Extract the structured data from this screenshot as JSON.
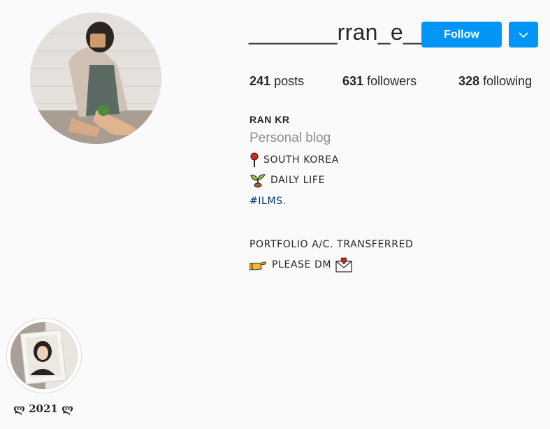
{
  "profile": {
    "username": "_______rran_e__",
    "follow_label": "Follow",
    "posts_count": "241",
    "posts_label": "posts",
    "followers_count": "631",
    "followers_label": "followers",
    "following_count": "328",
    "following_label": "following",
    "full_name": "RAN KR",
    "category": "Personal blog"
  },
  "bio": {
    "location": "SOUTH KOREA",
    "daily": "DAILY LIFE",
    "hashtag": "#ILMS.",
    "portfolio": "PORTFOLIO A/C. TRANSFERRED",
    "dm": "PLEASE DM"
  },
  "highlights": [
    {
      "label": "ლ 2021 ლ"
    }
  ],
  "colors": {
    "accent": "#0095f6",
    "muted": "#8e8e8e",
    "hashtag": "#00376b"
  },
  "icons": [
    "pin-icon",
    "sprout-icon",
    "pointing-hand-icon",
    "love-letter-icon",
    "chevron-down-icon"
  ]
}
